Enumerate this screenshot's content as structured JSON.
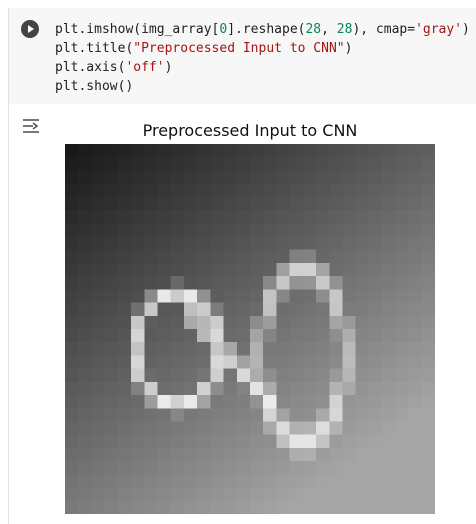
{
  "cell": {
    "code_lines": [
      [
        [
          "plt.imshow(img_array[",
          ""
        ],
        [
          "0",
          "num"
        ],
        [
          "].reshape(",
          ""
        ],
        [
          "28",
          "num"
        ],
        [
          ", ",
          ""
        ],
        [
          "28",
          "num"
        ],
        [
          "), cmap=",
          ""
        ],
        [
          "'gray'",
          "str"
        ],
        [
          ")",
          ""
        ]
      ],
      [
        [
          "plt.title(",
          ""
        ],
        [
          "\"Preprocessed Input to CNN\"",
          "str"
        ],
        [
          ")",
          ""
        ]
      ],
      [
        [
          "plt.axis(",
          ""
        ],
        [
          "'off'",
          "str"
        ],
        [
          ")",
          ""
        ]
      ],
      [
        [
          "plt.show()",
          ""
        ]
      ]
    ],
    "run_button_icon": "play-icon",
    "output_icon": "output-toggle-icon"
  },
  "figure": {
    "title": "Preprocessed Input to CNN",
    "image_rows": 28,
    "image_cols": 28,
    "cmap": "gray",
    "axis": "off"
  }
}
